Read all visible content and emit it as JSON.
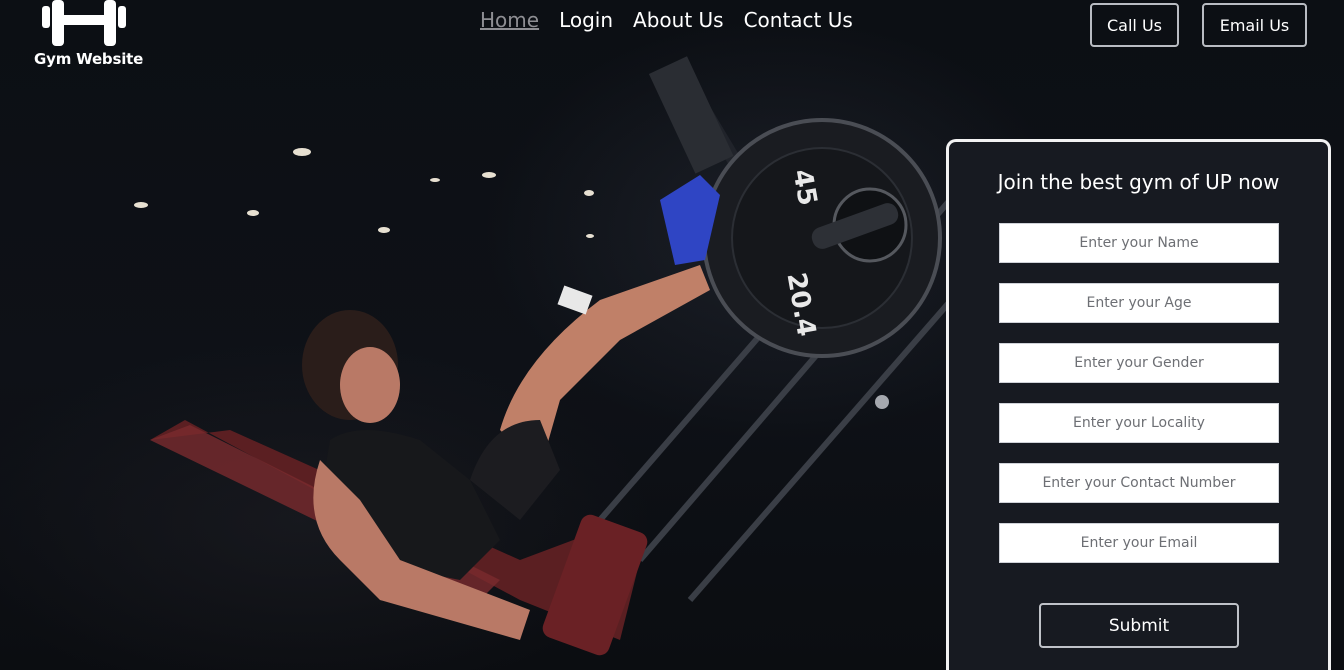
{
  "logo": {
    "icon": "dumbbell-icon",
    "text": "Gym Website"
  },
  "nav": {
    "items": [
      {
        "label": "Home",
        "active": true
      },
      {
        "label": "Login",
        "active": false
      },
      {
        "label": "About Us",
        "active": false
      },
      {
        "label": "Contact Us",
        "active": false
      }
    ]
  },
  "header_buttons": {
    "call": "Call Us",
    "email": "Email Us"
  },
  "form": {
    "title": "Join the best gym of UP now",
    "fields": {
      "name": "Enter your Name",
      "age": "Enter your Age",
      "gender": "Enter your Gender",
      "locality": "Enter your Locality",
      "contact": "Enter your Contact Number",
      "email": "Enter your Email"
    },
    "submit": "Submit"
  },
  "colors": {
    "background": "#0b0d12",
    "form_panel": "#171a21",
    "nav_active": "#8e8e93",
    "text": "#ffffff"
  }
}
